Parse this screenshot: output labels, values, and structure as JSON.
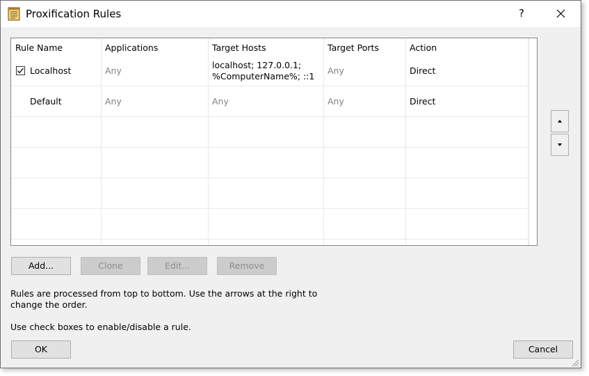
{
  "window": {
    "title": "Proxification Rules",
    "help_label": "?"
  },
  "grid": {
    "columns": [
      "Rule Name",
      "Applications",
      "Target Hosts",
      "Target Ports",
      "Action"
    ],
    "rows": [
      {
        "enabled": true,
        "name": "Localhost",
        "applications": "Any",
        "hosts_line1": "localhost; 127.0.0.1;",
        "hosts_line2": "%ComputerName%; ::1",
        "ports": "Any",
        "action": "Direct"
      },
      {
        "name": "Default",
        "applications": "Any",
        "hosts": "Any",
        "ports": "Any",
        "action": "Direct"
      }
    ]
  },
  "buttons": {
    "add": "Add...",
    "clone": "Clone",
    "edit": "Edit...",
    "remove": "Remove",
    "ok": "OK",
    "cancel": "Cancel"
  },
  "info": {
    "line1": "Rules are processed from top to bottom. Use the arrows at the right to change the order.",
    "line2": "Use check boxes to enable/disable a rule."
  }
}
